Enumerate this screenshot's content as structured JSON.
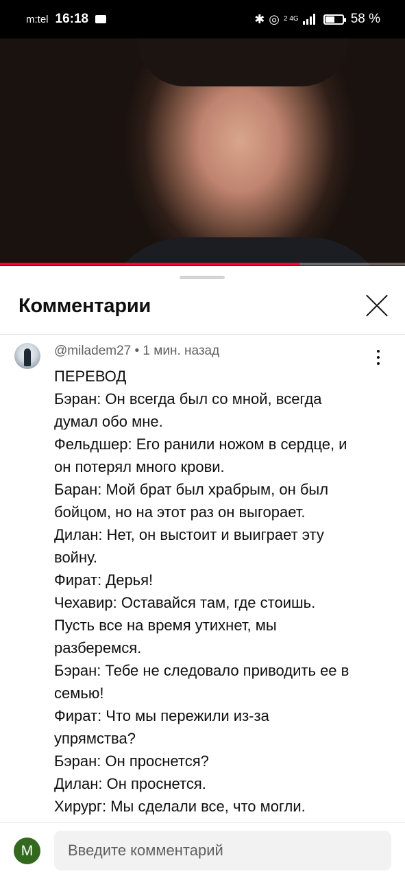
{
  "status_bar": {
    "carrier": "m:tel",
    "time": "16:18",
    "network_label": "2 4G",
    "battery_percent": 58,
    "battery_label": "58 %"
  },
  "video": {
    "progress": 0.74,
    "progress_color": "#ff0033"
  },
  "comments_panel": {
    "title": "Комментарии",
    "comment": {
      "meta": "@miladem27 • 1 мин. назад",
      "lines": [
        "ПЕРЕВОД",
        "Бэран: Он всегда был со мной, всегда",
        "думал обо мне.",
        "Фельдшер: Его ранили ножом в сердце, и",
        "он потерял много крови.",
        "Баран: Мой брат был храбрым, он был",
        "бойцом, но на этот раз он выгорает.",
        "Дилан: Нет, он выстоит и выиграет эту",
        "войну.",
        "Фират: Дерья!",
        "Чехавир: Оставайся там, где стоишь.",
        "Пусть все на время утихнет, мы",
        "разберемся.",
        "Бэран: Тебе не следовало приводить ее в",
        "семью!",
        "Фират: Что мы пережили из-за",
        "упрямства?",
        "Бэран: Он проснется?",
        "Дилан: Он проснется.",
        "Хирург: Мы сделали все, что могли."
      ]
    },
    "input": {
      "avatar_letter": "M",
      "avatar_color": "#33691e",
      "placeholder": "Введите комментарий"
    }
  }
}
